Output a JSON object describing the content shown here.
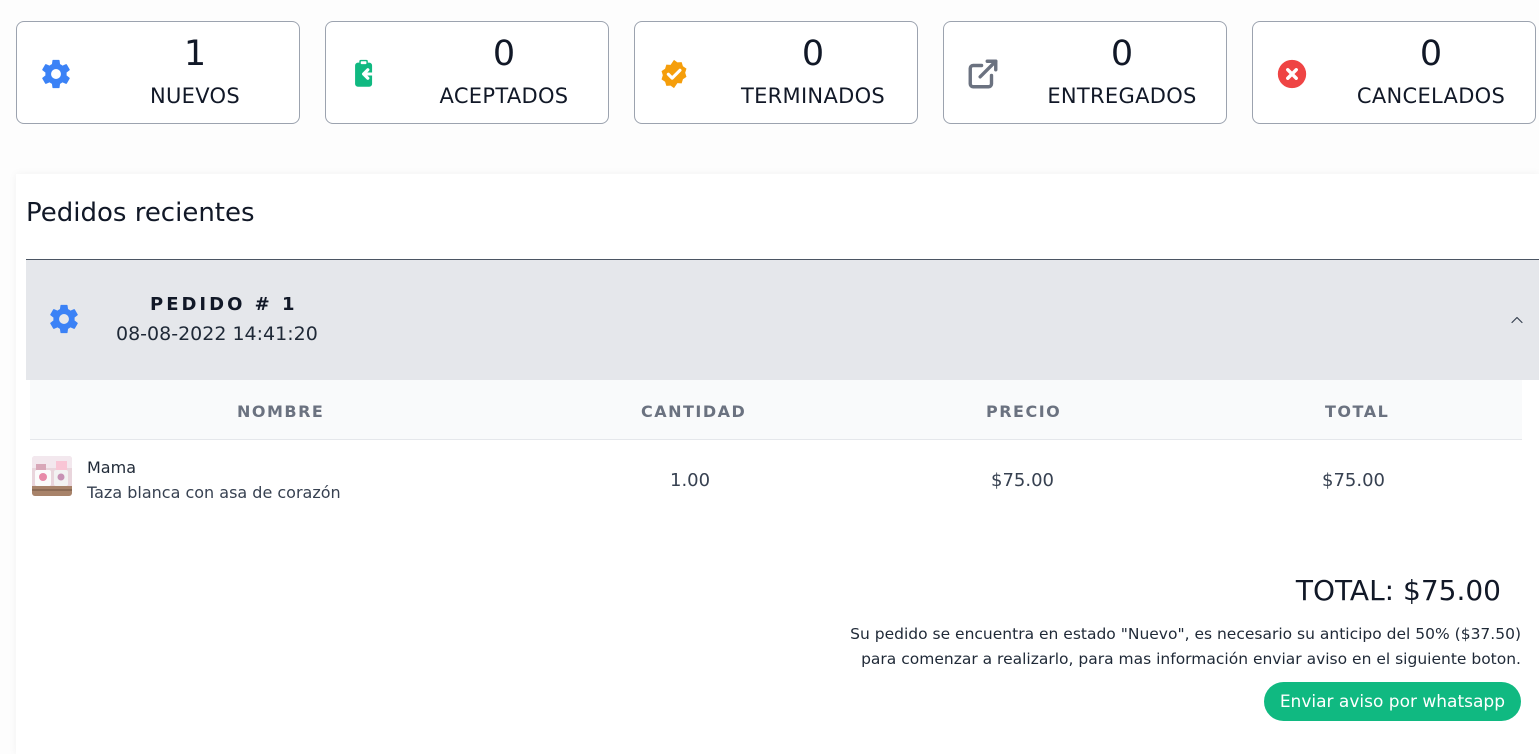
{
  "stats": [
    {
      "count": "1",
      "label": "NUEVOS",
      "icon": "gear-icon",
      "color": "#3b82f6"
    },
    {
      "count": "0",
      "label": "ACEPTADOS",
      "icon": "clipboard-return-icon",
      "color": "#10b981"
    },
    {
      "count": "0",
      "label": "TERMINADOS",
      "icon": "badge-check-icon",
      "color": "#f59e0b"
    },
    {
      "count": "0",
      "label": "ENTREGADOS",
      "icon": "external-link-icon",
      "color": "#6b7280"
    },
    {
      "count": "0",
      "label": "CANCELADOS",
      "icon": "x-circle-icon",
      "color": "#ef4444"
    }
  ],
  "panel": {
    "title": "Pedidos recientes",
    "order": {
      "number": "PEDIDO # 1",
      "date": "08-08-2022 14:41:20",
      "status_icon": "gear-icon",
      "status_color": "#3b82f6",
      "toggle_icon": "chevron-up-icon"
    },
    "table": {
      "headers": [
        "NOMBRE",
        "CANTIDAD",
        "PRECIO",
        "TOTAL"
      ],
      "rows": [
        {
          "name": "Mama",
          "description": "Taza blanca con asa de corazón",
          "quantity": "1.00",
          "price": "$75.00",
          "total": "$75.00"
        }
      ]
    },
    "total": "TOTAL: $75.00",
    "notice_line1": "Su pedido se encuentra en estado \"Nuevo\", es necesario su anticipo del 50% ($37.50)",
    "notice_line2": "para comenzar a realizarlo, para mas información enviar aviso en el siguiente boton.",
    "whatsapp_button": "Enviar aviso por whatsapp"
  }
}
